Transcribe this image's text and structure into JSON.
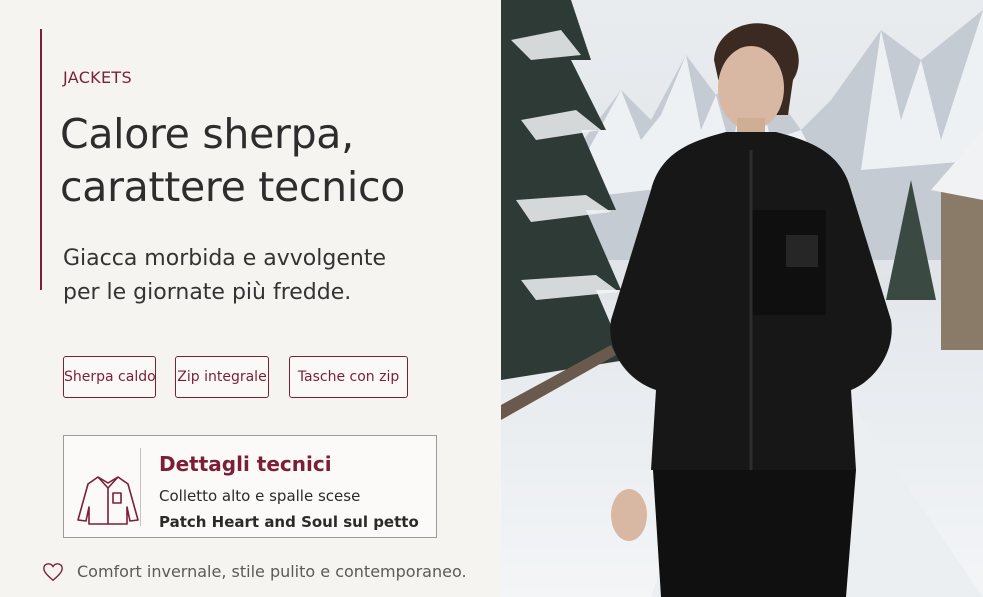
{
  "hero": {
    "category": "JACKETS",
    "headline_line1": "Calore sherpa,",
    "headline_line2": "carattere tecnico",
    "subtitle_line1": "Giacca morbida e avvolgente",
    "subtitle_line2": "per le giornate più fredde."
  },
  "features": [
    {
      "label": "Sherpa caldo"
    },
    {
      "label": "Zip integrale"
    },
    {
      "label": "Tasche con zip"
    }
  ],
  "details": {
    "icon": "jacket-outline-icon",
    "title": "Dettagli tecnici",
    "line1": "Colletto alto e spalle scese",
    "line2": "Patch Heart and Soul sul petto"
  },
  "footer": {
    "icon": "heart-outline-icon",
    "tagline": "Comfort invernale, stile pulito e contemporaneo."
  },
  "colors": {
    "accent": "#7a1f35",
    "background": "#f6f4f1",
    "text": "#2d2d2d"
  }
}
